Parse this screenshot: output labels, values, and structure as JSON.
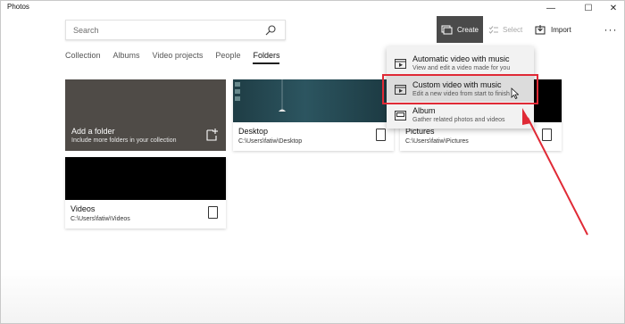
{
  "window": {
    "title": "Photos",
    "controls": {
      "minimize": "—",
      "maximize": "☐",
      "close": "✕"
    }
  },
  "search": {
    "placeholder": "Search",
    "icon": "search-icon"
  },
  "toolbar": {
    "create_label": "Create",
    "select_label": "Select",
    "import_label": "Import",
    "more_label": "···"
  },
  "tabs": [
    {
      "label": "Collection",
      "active": false
    },
    {
      "label": "Albums",
      "active": false
    },
    {
      "label": "Video projects",
      "active": false
    },
    {
      "label": "People",
      "active": false
    },
    {
      "label": "Folders",
      "active": true
    }
  ],
  "add_folder": {
    "title": "Add a folder",
    "subtitle": "Include more folders in your collection"
  },
  "folders": [
    {
      "name": "Desktop",
      "path": "C:\\Users\\fatiw\\Desktop"
    },
    {
      "name": "Pictures",
      "path": "C:\\Users\\fatiw\\Pictures"
    },
    {
      "name": "Videos",
      "path": "C:\\Users\\fatiw\\Videos"
    }
  ],
  "create_menu": [
    {
      "title": "Automatic video with music",
      "subtitle": "View and edit a video made for you"
    },
    {
      "title": "Custom video with music",
      "subtitle": "Edit a new video from start to finish"
    },
    {
      "title": "Album",
      "subtitle": "Gather related photos and videos"
    }
  ],
  "colors": {
    "accent_highlight": "#e02a36",
    "create_button": "#4a4a4a",
    "add_card": "#4f4b47"
  }
}
